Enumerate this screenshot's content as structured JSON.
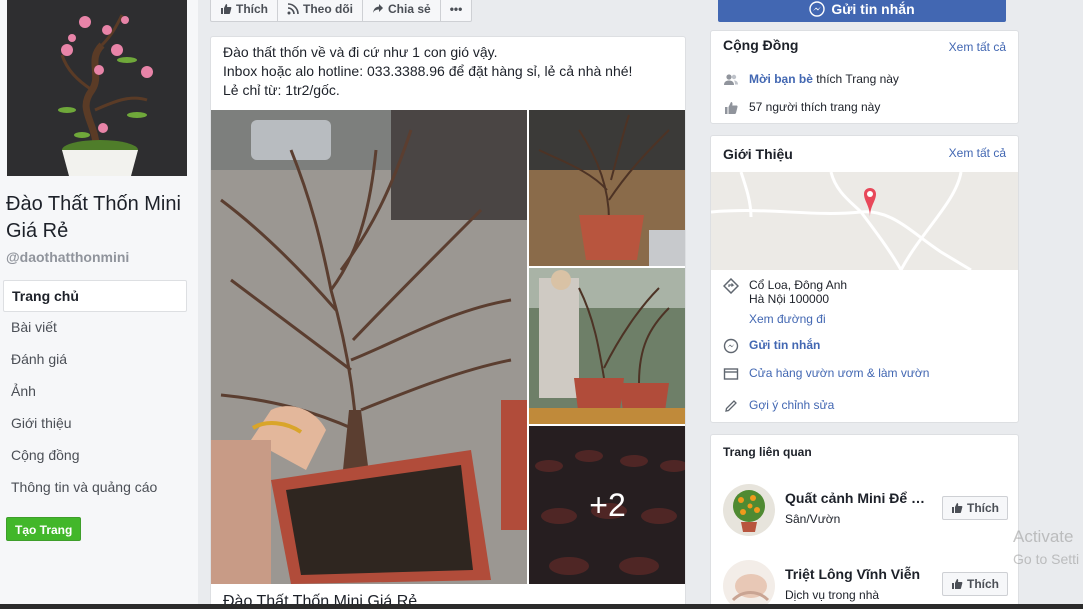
{
  "page": {
    "name": "Đào Thất Thốn Mini Giá Rẻ",
    "handle": "@daothatthonmini"
  },
  "nav": {
    "items": [
      {
        "label": "Trang chủ",
        "active": true
      },
      {
        "label": "Bài viết"
      },
      {
        "label": "Đánh giá"
      },
      {
        "label": "Ảnh"
      },
      {
        "label": "Giới thiệu"
      },
      {
        "label": "Cộng đồng"
      },
      {
        "label": "Thông tin và quảng cáo"
      }
    ],
    "create_page": "Tạo Trang"
  },
  "action_bar": {
    "like": "Thích",
    "follow": "Theo dõi",
    "share": "Chia sẻ",
    "more": "•••",
    "send_message": "Gửi tin nhắn"
  },
  "post": {
    "lines": [
      "Đào thất thốn về và đi cứ như 1 con gió vậy.",
      "Inbox hoặc alo hotline: 033.3388.96 để đặt hàng sỉ, lẻ cả nhà nhé!",
      "Lẻ chỉ từ: 1tr2/gốc."
    ],
    "more_photos": "+2",
    "footer_title": "Đào Thất Thốn Mini Giá Rẻ"
  },
  "community": {
    "title": "Cộng Đồng",
    "see_all": "Xem tất cả",
    "invite_link": "Mời bạn bè",
    "invite_text": " thích Trang này",
    "likes": "57 người thích trang này"
  },
  "about": {
    "title": "Giới Thiệu",
    "see_all": "Xem tất cả",
    "address_line1": "Cổ Loa, Đông Anh",
    "address_line2": "Hà Nội 100000",
    "directions": "Xem đường đi",
    "send_message": "Gửi tin nhắn",
    "category": "Cửa hàng vườn ươm & làm vườn",
    "suggest_edit": "Gợi ý chỉnh sửa"
  },
  "related": {
    "title": "Trang liên quan",
    "items": [
      {
        "name": "Quất cảnh Mini Để Bàn",
        "category": "Sân/Vườn",
        "like": "Thích"
      },
      {
        "name": "Triệt Lông Vĩnh Viễn",
        "category": "Dịch vụ trong nhà",
        "like": "Thích"
      }
    ]
  },
  "watermark": {
    "line1": "Activate",
    "line2": "Go to Setti"
  },
  "colors": {
    "brand": "#4267b2",
    "create_button": "#42b72a",
    "map_pin": "#e8485a"
  }
}
